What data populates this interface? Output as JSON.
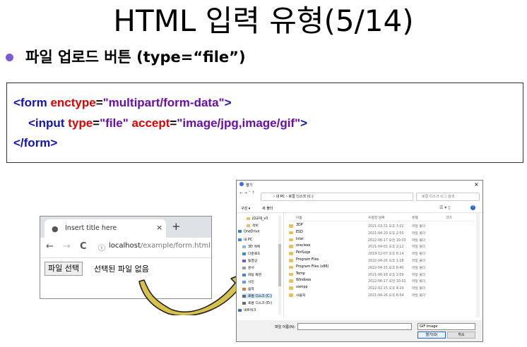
{
  "slide": {
    "title": "HTML 입력 유형(5/14)",
    "bullet": "파일 업로드 버튼 (type=“file”)"
  },
  "code": {
    "line1": {
      "open": "<form ",
      "attr": "enctype",
      "eq": "=",
      "val": "\"multipart/form-data\"",
      "close": ">"
    },
    "line2": {
      "open": "<input ",
      "attr1": "type",
      "eq1": "=",
      "val1": "\"file\"",
      "attr2": "accept",
      "eq2": "=",
      "val2": "\"image/jpg,image/gif\"",
      "close": ">"
    },
    "line3": {
      "text": "</form>"
    }
  },
  "browser": {
    "tab_title": "Insert title here",
    "tab_close": "×",
    "new_tab": "+",
    "back": "←",
    "forward": "→",
    "reload": "C",
    "info_icon": "ⓘ",
    "url_host": "localhost",
    "url_path": "/example/form.html",
    "file_button": "파일 선택",
    "file_status": "선택된 파일 없음"
  },
  "dialog": {
    "title": "열기",
    "close": "×",
    "path_text": "›  내 PC  ›  로컬 디스크 (C:)",
    "search_placeholder": "로컬 디스크 (C:) 검색",
    "organize": "구성 ▾",
    "new_folder": "새 폴더",
    "help": "?",
    "nav": [
      "jQ교재_v3",
      "석비",
      "OneDrive",
      "내 PC",
      "3D 개체",
      "다운로드",
      "동영상",
      "문서",
      "바탕 화면",
      "사진",
      "음악",
      "로컬 디스크 (C:)",
      "로컬 디스크 (D:)",
      "네트워크"
    ],
    "columns": {
      "name": "이름",
      "date": "수정한 날짜",
      "type": "유형",
      "size": "크기"
    },
    "files": [
      {
        "name": "3DP",
        "date": "2021-03-31 오후 7:02",
        "type": "파일 폴더"
      },
      {
        "name": "ESD",
        "date": "2021-04-20 오후 2:50",
        "type": "파일 폴더"
      },
      {
        "name": "Intel",
        "date": "2022-06-17 오전 10:03",
        "type": "파일 폴더"
      },
      {
        "name": "oraclexe",
        "date": "2021-04-01 오후 2:12",
        "type": "파일 폴더"
      },
      {
        "name": "PerfLogs",
        "date": "2019-12-07 오후 6:14",
        "type": "파일 폴더"
      },
      {
        "name": "Program Files",
        "date": "2022-04-26 오후 1:28",
        "type": "파일 폴더"
      },
      {
        "name": "Program Files (x86)",
        "date": "2022-04-15 오후 6:40",
        "type": "파일 폴더"
      },
      {
        "name": "Temp",
        "date": "2021-06-18 오후 2:09",
        "type": "파일 폴더"
      },
      {
        "name": "Windows",
        "date": "2022-06-17 오전 10:01",
        "type": "파일 폴더"
      },
      {
        "name": "xampp",
        "date": "2022-02-15 오후 4:24",
        "type": "파일 폴더"
      },
      {
        "name": "사용자",
        "date": "2021-04-26 오후 6:54",
        "type": "파일 폴더"
      }
    ],
    "filename_label": "파일 이름(N):",
    "filter": "GIF Image",
    "open_button": "열기(O)",
    "cancel_button": "취소"
  }
}
